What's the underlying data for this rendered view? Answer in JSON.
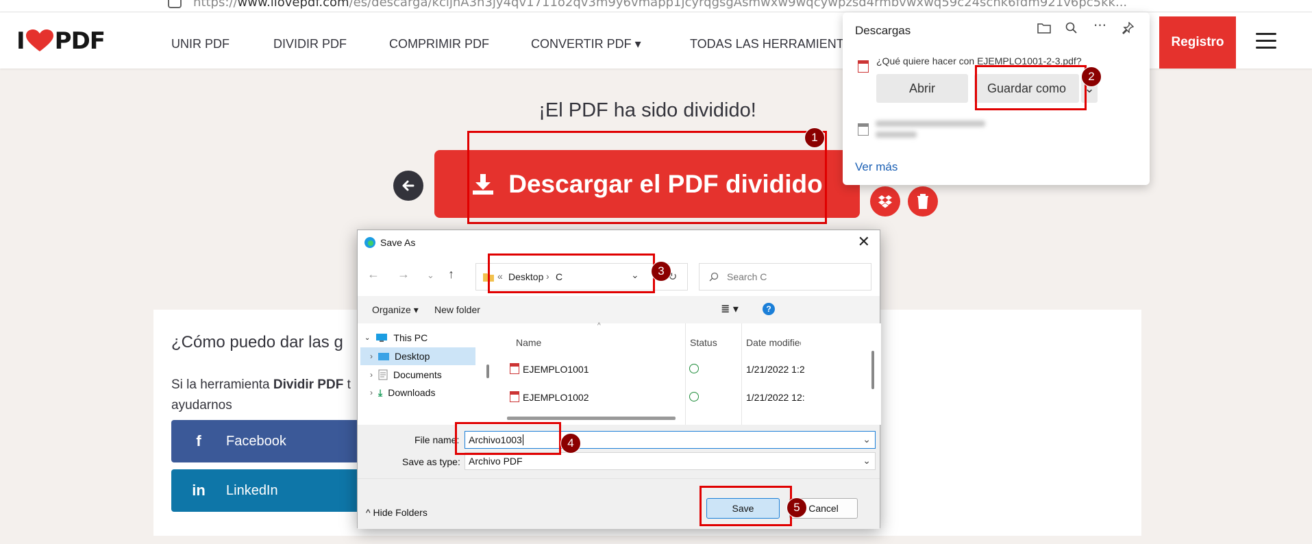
{
  "browser": {
    "url_prefix": "https://",
    "url_domain": "www.ilovepdf.com",
    "url_rest": "/es/descarga/kcljhA3n3jy4qv1711o2qv3m9y6vmapp1jcyrqgsgAsmwxw9wqcywpzsd4rmbvwxwq59c24schk6fdm921v6pc5kk..."
  },
  "nav": {
    "logo_left": "I",
    "logo_right": "PDF",
    "links": [
      "UNIR PDF",
      "DIVIDIR PDF",
      "COMPRIMIR PDF",
      "CONVERTIR PDF ▾",
      "TODAS LAS HERRAMIENTAS"
    ],
    "registro": "Registro"
  },
  "main": {
    "title": "¡El PDF ha sido dividido!",
    "download_button": "Descargar el PDF dividido"
  },
  "card": {
    "heading": "¿Cómo puedo dar las g",
    "text_prefix": "Si la herramienta ",
    "text_bold": "Dividir PDF",
    "text_suffix": " t",
    "text_line2": "ayudarnos",
    "facebook": "Facebook",
    "linkedin": "LinkedIn"
  },
  "downloads": {
    "header": "Descargas",
    "question": "¿Qué quiere hacer con EJEMPLO1001-2-3.pdf?",
    "open": "Abrir",
    "save_as": "Guardar como",
    "more": "Ver más"
  },
  "dialog": {
    "title": "Save As",
    "breadcrumb_sep": "«",
    "path": [
      "Desktop",
      "C"
    ],
    "search_placeholder": "Search C",
    "organize": "Organize ▾",
    "new_folder": "New folder",
    "nav_items": [
      "This PC",
      "Desktop",
      "Documents",
      "Downloads"
    ],
    "columns": [
      "Name",
      "Status",
      "Date modified"
    ],
    "files": [
      {
        "name": "EJEMPLO1001",
        "date": "1/21/2022 1:2"
      },
      {
        "name": "EJEMPLO1002",
        "date": "1/21/2022 12:"
      }
    ],
    "file_name_label": "File name:",
    "file_name_value": "Archivo1003",
    "save_type_label": "Save as type:",
    "save_type_value": "Archivo PDF",
    "hide_folders": "Hide Folders",
    "save": "Save",
    "cancel": "Cancel"
  },
  "annotations": [
    "1",
    "2",
    "3",
    "4",
    "5"
  ],
  "colors": {
    "brand_red": "#e5322d",
    "annotation_red": "#e00000",
    "badge": "#8b0000",
    "facebook": "#3b5998",
    "linkedin": "#0e76a8"
  }
}
